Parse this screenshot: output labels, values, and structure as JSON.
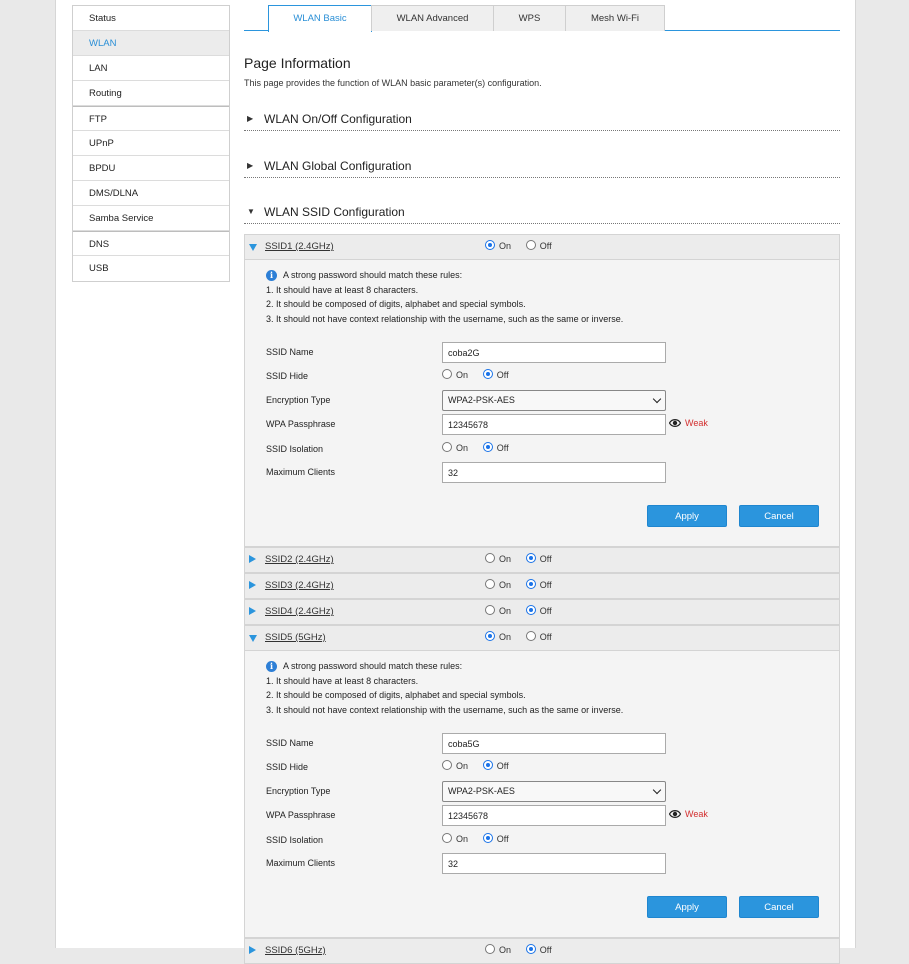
{
  "sidebar": {
    "items": [
      {
        "label": "Status"
      },
      {
        "label": "WLAN"
      },
      {
        "label": "LAN"
      },
      {
        "label": "Routing"
      },
      {
        "label": "FTP"
      },
      {
        "label": "UPnP"
      },
      {
        "label": "BPDU"
      },
      {
        "label": "DMS/DLNA"
      },
      {
        "label": "Samba Service"
      },
      {
        "label": "DNS"
      },
      {
        "label": "USB"
      }
    ],
    "active": "WLAN"
  },
  "tabs": [
    {
      "label": "WLAN Basic"
    },
    {
      "label": "WLAN Advanced"
    },
    {
      "label": "WPS"
    },
    {
      "label": "Mesh Wi-Fi"
    }
  ],
  "page": {
    "title": "Page Information",
    "description": "This page provides the function of WLAN basic parameter(s) configuration."
  },
  "sections": {
    "onoff": "WLAN On/Off Configuration",
    "global": "WLAN Global Configuration",
    "ssid": "WLAN SSID Configuration"
  },
  "common": {
    "on": "On",
    "off": "Off",
    "info_title": "A strong password should match these rules:",
    "rule1": "1. It should have at least 8 characters.",
    "rule2": "2. It should be composed of digits, alphabet and special symbols.",
    "rule3": "3. It should not have context relationship with the username, such as the same or inverse.",
    "ssid_name_label": "SSID Name",
    "ssid_hide_label": "SSID Hide",
    "encryption_label": "Encryption Type",
    "passphrase_label": "WPA Passphrase",
    "isolation_label": "SSID Isolation",
    "max_clients_label": "Maximum Clients",
    "apply": "Apply",
    "cancel": "Cancel",
    "strength": "Weak"
  },
  "ssids": {
    "ssid1": {
      "title": "SSID1 (2.4GHz)",
      "enabled": true,
      "name": "coba2G",
      "hide": false,
      "encryption": "WPA2-PSK-AES",
      "passphrase": "12345678",
      "isolation": false,
      "max_clients": "32"
    },
    "ssid2": {
      "title": "SSID2 (2.4GHz)",
      "enabled": false
    },
    "ssid3": {
      "title": "SSID3 (2.4GHz)",
      "enabled": false
    },
    "ssid4": {
      "title": "SSID4 (2.4GHz)",
      "enabled": false
    },
    "ssid5": {
      "title": "SSID5 (5GHz)",
      "enabled": true,
      "name": "coba5G",
      "hide": false,
      "encryption": "WPA2-PSK-AES",
      "passphrase": "12345678",
      "isolation": false,
      "max_clients": "32"
    },
    "ssid6": {
      "title": "SSID6 (5GHz)",
      "enabled": false
    }
  },
  "colors": {
    "accent": "#2b95dd",
    "weak": "#d32f2f"
  }
}
